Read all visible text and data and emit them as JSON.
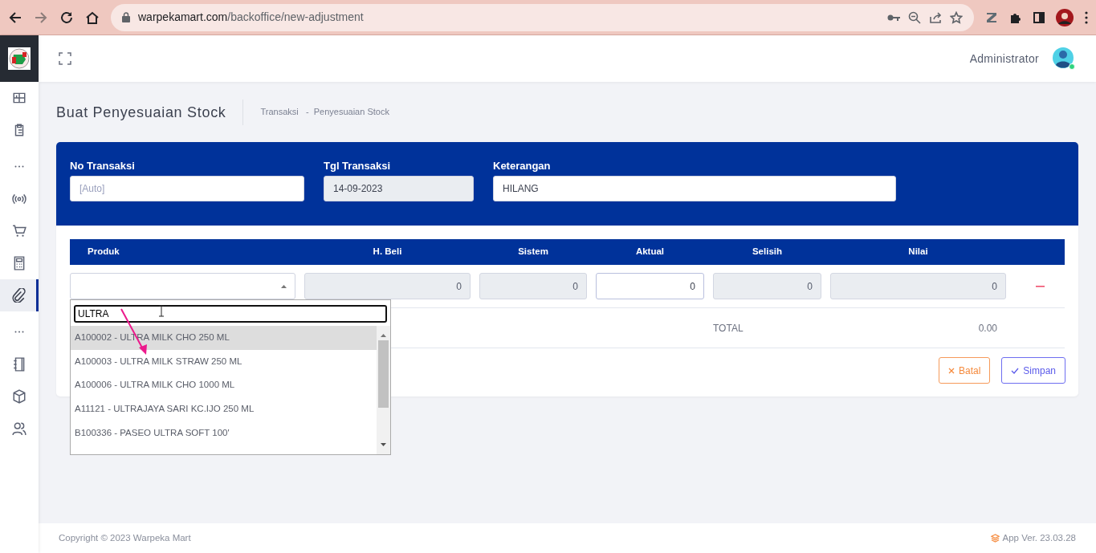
{
  "browser": {
    "forward_enabled": false,
    "url_host": "warpekamart.com",
    "url_path": "/backoffice/new-adjustment"
  },
  "sidebar": {
    "items": [
      {
        "kind": "icon",
        "selected": false
      },
      {
        "kind": "icon",
        "selected": false
      },
      {
        "kind": "dots"
      },
      {
        "kind": "icon",
        "selected": false
      },
      {
        "kind": "icon",
        "selected": false
      },
      {
        "kind": "icon",
        "selected": false
      },
      {
        "kind": "icon",
        "selected": true
      },
      {
        "kind": "dots"
      },
      {
        "kind": "icon",
        "selected": false
      },
      {
        "kind": "icon",
        "selected": false
      },
      {
        "kind": "icon",
        "selected": false
      }
    ]
  },
  "header": {
    "user": "Administrator"
  },
  "page": {
    "title": "Buat Penyesuaian Stock",
    "breadcrumb": [
      "Transaksi",
      "Penyesuaian Stock"
    ],
    "breadcrumb_separator": "-"
  },
  "form": {
    "fields": [
      {
        "label": "No Transaksi",
        "placeholder": "[Auto]",
        "disabled": false
      },
      {
        "label": "Tgl Transaksi",
        "value": "14-09-2023",
        "disabled": true
      },
      {
        "label": "Keterangan",
        "value": "HILANG",
        "disabled": false
      }
    ]
  },
  "table": {
    "columns": [
      "Produk",
      "H. Beli",
      "Sistem",
      "Aktual",
      "Selisih",
      "Nilai"
    ],
    "rows": [
      {
        "cells": [
          {
            "value": "0",
            "disabled": true
          },
          {
            "value": "0",
            "disabled": true
          },
          {
            "value": "0",
            "disabled": false
          },
          {
            "value": "0",
            "disabled": true
          },
          {
            "value": "0",
            "disabled": true
          }
        ]
      }
    ],
    "total_label": "TOTAL",
    "total_value": "0.00"
  },
  "dropdown": {
    "search": "ULTRA",
    "options": [
      {
        "label": "A100002 - ULTRA MILK CHO 250 ML",
        "selected": true
      },
      {
        "label": "A100003 - ULTRA MILK STRAW 250 ML",
        "selected": false
      },
      {
        "label": "A100006 - ULTRA MILK CHO 1000 ML",
        "selected": false
      },
      {
        "label": "A11121 - ULTRAJAYA SARI KC.IJO 250 ML",
        "selected": false
      },
      {
        "label": "B100336 - PASEO ULTRA SOFT 100'",
        "selected": false
      }
    ]
  },
  "buttons": [
    {
      "label": "Batal",
      "kind": "cancel"
    },
    {
      "label": "Simpan",
      "kind": "save"
    }
  ],
  "footer": {
    "copyright": "Copyright © 2023 Warpeka Mart",
    "version": "App Ver. 23.03.28"
  }
}
